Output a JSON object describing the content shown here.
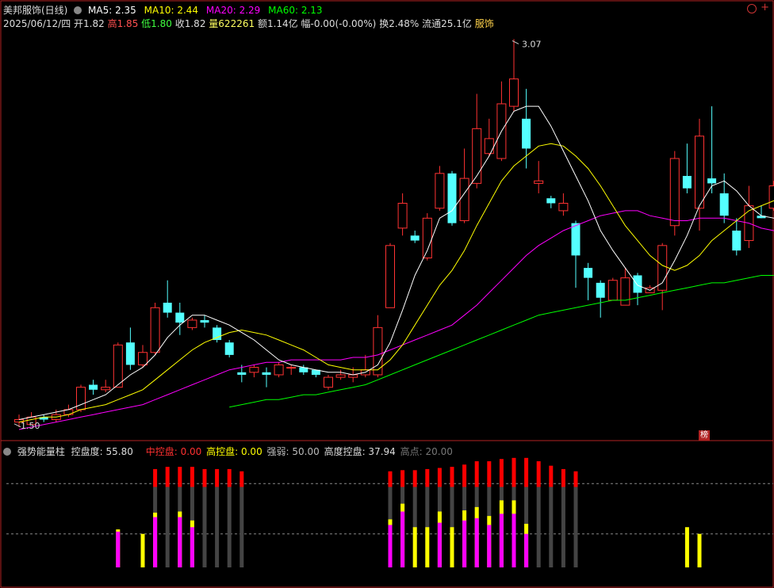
{
  "header": {
    "stock_name": "美邦服饰(日线)",
    "ma5": "MA5: 2.35",
    "ma10": "MA10: 2.44",
    "ma20": "MA20: 2.29",
    "ma60": "MA60: 2.13"
  },
  "quote": {
    "date": "2025/06/12/四",
    "open": "开1.82",
    "high": "高1.85",
    "low": "低1.80",
    "close": "收1.82",
    "volume": "量622261",
    "amount": "额1.14亿",
    "change": "幅-0.00(-0.00%)",
    "turnover": "换2.48%",
    "float": "流通25.1亿",
    "sector": "服饰"
  },
  "indicator_header": {
    "name": "强势能量柱",
    "control": "控盘度: 55.80",
    "mid": "中控盘: 0.00",
    "high_ctrl": "高控盘: 0.00",
    "strong_weak": "强弱: 50.00",
    "high_degree": "高度控盘: 37.94",
    "high_point": "高点: 20.00"
  },
  "badge": "榜",
  "colors": {
    "up": "#ff3232",
    "down": "#54ffff",
    "ma5": "#ffffff",
    "ma10": "#ffff00",
    "ma20": "#ff00ff",
    "ma60": "#00ff00",
    "frame": "#b22222"
  },
  "chart_data": [
    {
      "type": "candlestick",
      "title": "美邦服饰(日线)",
      "ylim": [
        1.5,
        3.1
      ],
      "annotations": [
        {
          "label": "3.07",
          "note": "high"
        },
        {
          "label": "1.50",
          "note": "low"
        }
      ],
      "candles": [
        [
          1.53,
          1.54,
          1.56,
          1.51
        ],
        [
          1.52,
          1.55,
          1.57,
          1.52
        ],
        [
          1.55,
          1.54,
          1.56,
          1.53
        ],
        [
          1.54,
          1.56,
          1.58,
          1.53
        ],
        [
          1.56,
          1.58,
          1.6,
          1.55
        ],
        [
          1.58,
          1.67,
          1.68,
          1.57
        ],
        [
          1.68,
          1.66,
          1.7,
          1.64
        ],
        [
          1.66,
          1.67,
          1.7,
          1.65
        ],
        [
          1.67,
          1.84,
          1.85,
          1.67
        ],
        [
          1.85,
          1.76,
          1.91,
          1.74
        ],
        [
          1.76,
          1.81,
          1.84,
          1.75
        ],
        [
          1.81,
          1.99,
          2.01,
          1.8
        ],
        [
          2.01,
          1.97,
          2.1,
          1.95
        ],
        [
          1.97,
          1.93,
          2.01,
          1.88
        ],
        [
          1.91,
          1.94,
          1.95,
          1.9
        ],
        [
          1.94,
          1.93,
          1.96,
          1.91
        ],
        [
          1.91,
          1.86,
          1.92,
          1.85
        ],
        [
          1.85,
          1.8,
          1.86,
          1.79
        ],
        [
          1.73,
          1.72,
          1.76,
          1.69
        ],
        [
          1.73,
          1.75,
          1.76,
          1.71
        ],
        [
          1.73,
          1.72,
          1.75,
          1.67
        ],
        [
          1.72,
          1.76,
          1.77,
          1.71
        ],
        [
          1.75,
          1.75,
          1.76,
          1.72
        ],
        [
          1.75,
          1.73,
          1.76,
          1.72
        ],
        [
          1.74,
          1.72,
          1.73,
          1.71
        ],
        [
          1.67,
          1.71,
          1.72,
          1.66
        ],
        [
          1.71,
          1.72,
          1.74,
          1.7
        ],
        [
          1.71,
          1.72,
          1.75,
          1.69
        ],
        [
          1.72,
          1.74,
          1.8,
          1.71
        ],
        [
          1.72,
          1.91,
          1.96,
          1.71
        ],
        [
          1.99,
          2.24,
          2.25,
          1.99
        ],
        [
          2.31,
          2.41,
          2.45,
          2.28
        ],
        [
          2.28,
          2.26,
          2.3,
          2.25
        ],
        [
          2.19,
          2.35,
          2.37,
          2.18
        ],
        [
          2.39,
          2.53,
          2.56,
          2.38
        ],
        [
          2.53,
          2.33,
          2.54,
          2.32
        ],
        [
          2.34,
          2.51,
          2.63,
          2.33
        ],
        [
          2.49,
          2.71,
          2.85,
          2.47
        ],
        [
          2.61,
          2.67,
          2.75,
          2.6
        ],
        [
          2.59,
          2.81,
          2.9,
          2.58
        ],
        [
          2.8,
          2.91,
          3.07,
          2.78
        ],
        [
          2.75,
          2.63,
          2.87,
          2.55
        ],
        [
          2.49,
          2.5,
          2.58,
          2.45
        ],
        [
          2.43,
          2.41,
          2.44,
          2.39
        ],
        [
          2.38,
          2.41,
          2.45,
          2.36
        ],
        [
          2.33,
          2.2,
          2.34,
          2.07
        ],
        [
          2.15,
          2.11,
          2.17,
          2.02
        ],
        [
          2.09,
          2.03,
          2.1,
          1.95
        ],
        [
          2.02,
          2.1,
          2.11,
          2.02
        ],
        [
          2.0,
          2.11,
          2.15,
          2.0
        ],
        [
          2.12,
          2.05,
          2.13,
          2.0
        ],
        [
          2.05,
          2.07,
          2.08,
          2.05
        ],
        [
          2.06,
          2.24,
          2.25,
          1.98
        ],
        [
          2.32,
          2.59,
          2.62,
          2.28
        ],
        [
          2.52,
          2.47,
          2.65,
          2.45
        ],
        [
          2.39,
          2.68,
          2.75,
          2.3
        ],
        [
          2.51,
          2.49,
          2.8,
          2.45
        ],
        [
          2.45,
          2.36,
          2.53,
          2.33
        ],
        [
          2.3,
          2.22,
          2.35,
          2.2
        ],
        [
          2.26,
          2.4,
          2.48,
          2.23
        ],
        [
          2.36,
          2.35,
          2.4,
          2.35
        ],
        [
          2.39,
          2.48,
          2.5,
          2.38
        ],
        [
          2.38,
          2.55,
          2.72,
          2.35
        ]
      ],
      "ma5": [
        1.54,
        1.55,
        1.56,
        1.57,
        1.58,
        1.6,
        1.62,
        1.64,
        1.68,
        1.72,
        1.75,
        1.8,
        1.87,
        1.92,
        1.96,
        1.96,
        1.94,
        1.92,
        1.89,
        1.86,
        1.82,
        1.78,
        1.76,
        1.75,
        1.74,
        1.73,
        1.73,
        1.72,
        1.73,
        1.76,
        1.85,
        1.98,
        2.12,
        2.22,
        2.35,
        2.38,
        2.45,
        2.52,
        2.6,
        2.7,
        2.78,
        2.8,
        2.8,
        2.72,
        2.62,
        2.52,
        2.42,
        2.3,
        2.22,
        2.15,
        2.08,
        2.06,
        2.09,
        2.18,
        2.28,
        2.4,
        2.48,
        2.5,
        2.46,
        2.4,
        2.36,
        2.35,
        2.36
      ],
      "ma10": [
        1.53,
        1.54,
        1.55,
        1.55,
        1.56,
        1.58,
        1.59,
        1.6,
        1.62,
        1.64,
        1.66,
        1.7,
        1.74,
        1.78,
        1.82,
        1.85,
        1.87,
        1.89,
        1.9,
        1.89,
        1.88,
        1.86,
        1.84,
        1.82,
        1.79,
        1.76,
        1.75,
        1.74,
        1.74,
        1.74,
        1.78,
        1.84,
        1.92,
        2.0,
        2.08,
        2.14,
        2.22,
        2.32,
        2.41,
        2.5,
        2.56,
        2.6,
        2.64,
        2.65,
        2.64,
        2.6,
        2.55,
        2.48,
        2.4,
        2.32,
        2.26,
        2.2,
        2.16,
        2.14,
        2.16,
        2.2,
        2.26,
        2.3,
        2.34,
        2.38,
        2.4,
        2.42,
        2.44
      ],
      "ma20": [
        1.5,
        1.51,
        1.52,
        1.53,
        1.54,
        1.55,
        1.56,
        1.57,
        1.58,
        1.59,
        1.6,
        1.62,
        1.64,
        1.66,
        1.68,
        1.7,
        1.72,
        1.74,
        1.75,
        1.76,
        1.77,
        1.77,
        1.78,
        1.78,
        1.78,
        1.78,
        1.78,
        1.79,
        1.79,
        1.8,
        1.82,
        1.84,
        1.86,
        1.88,
        1.9,
        1.92,
        1.96,
        2.0,
        2.05,
        2.1,
        2.15,
        2.2,
        2.24,
        2.27,
        2.3,
        2.32,
        2.34,
        2.36,
        2.37,
        2.38,
        2.38,
        2.36,
        2.35,
        2.34,
        2.34,
        2.35,
        2.35,
        2.35,
        2.34,
        2.33,
        2.31,
        2.3,
        2.29
      ],
      "ma60": [
        null,
        null,
        null,
        null,
        null,
        null,
        null,
        null,
        null,
        null,
        null,
        null,
        null,
        null,
        null,
        null,
        null,
        1.59,
        1.6,
        1.61,
        1.62,
        1.62,
        1.63,
        1.64,
        1.64,
        1.65,
        1.66,
        1.67,
        1.68,
        1.7,
        1.72,
        1.74,
        1.76,
        1.78,
        1.8,
        1.82,
        1.84,
        1.86,
        1.88,
        1.9,
        1.92,
        1.94,
        1.96,
        1.97,
        1.98,
        1.99,
        2.0,
        2.01,
        2.02,
        2.02,
        2.03,
        2.04,
        2.05,
        2.06,
        2.07,
        2.08,
        2.09,
        2.09,
        2.1,
        2.11,
        2.12,
        2.12,
        2.13
      ]
    },
    {
      "type": "bar",
      "title": "强势能量柱",
      "ylim": [
        0,
        100
      ],
      "reference_lines": [
        75,
        30
      ],
      "series": [
        {
          "name": "红",
          "color": "#ff0000",
          "values": [
            0,
            0,
            0,
            0,
            0,
            0,
            0,
            0,
            0,
            0,
            0,
            0,
            0,
            0,
            0,
            0,
            0,
            0,
            0,
            0,
            0,
            0,
            0,
            0,
            0,
            0,
            0,
            0,
            0,
            0,
            0,
            0,
            0,
            0,
            0,
            0,
            0,
            0,
            0,
            0,
            0,
            0,
            0,
            0,
            0,
            0,
            0,
            0,
            0,
            0,
            0,
            0,
            0,
            0,
            0,
            0,
            0,
            0,
            0,
            0,
            0,
            0,
            0
          ]
        }
      ],
      "columns": [
        {
          "x": 8,
          "gray": 0,
          "red": 0,
          "mag": 36,
          "yel": 38
        },
        {
          "x": 10,
          "gray": 0,
          "red": 0,
          "mag": 0,
          "yel": 33
        },
        {
          "x": 11,
          "gray": 75,
          "red": 92,
          "mag": 47,
          "yel": 50
        },
        {
          "x": 12,
          "gray": 75,
          "red": 94,
          "mag": 0,
          "yel": 0
        },
        {
          "x": 13,
          "gray": 75,
          "red": 94,
          "mag": 0,
          "yel": 0
        },
        {
          "x": 14,
          "gray": 75,
          "red": 92,
          "mag": 0,
          "yel": 0
        },
        {
          "x": 15,
          "gray": 75,
          "red": 92,
          "mag": 0,
          "yel": 0
        },
        {
          "x": 16,
          "gray": 75,
          "red": 92,
          "mag": 0,
          "yel": 0
        },
        {
          "x": 17,
          "gray": 75,
          "red": 92,
          "mag": 0,
          "yel": 0
        },
        {
          "x": 18,
          "gray": 75,
          "red": 90,
          "mag": 0,
          "yel": 0
        }
      ]
    }
  ]
}
